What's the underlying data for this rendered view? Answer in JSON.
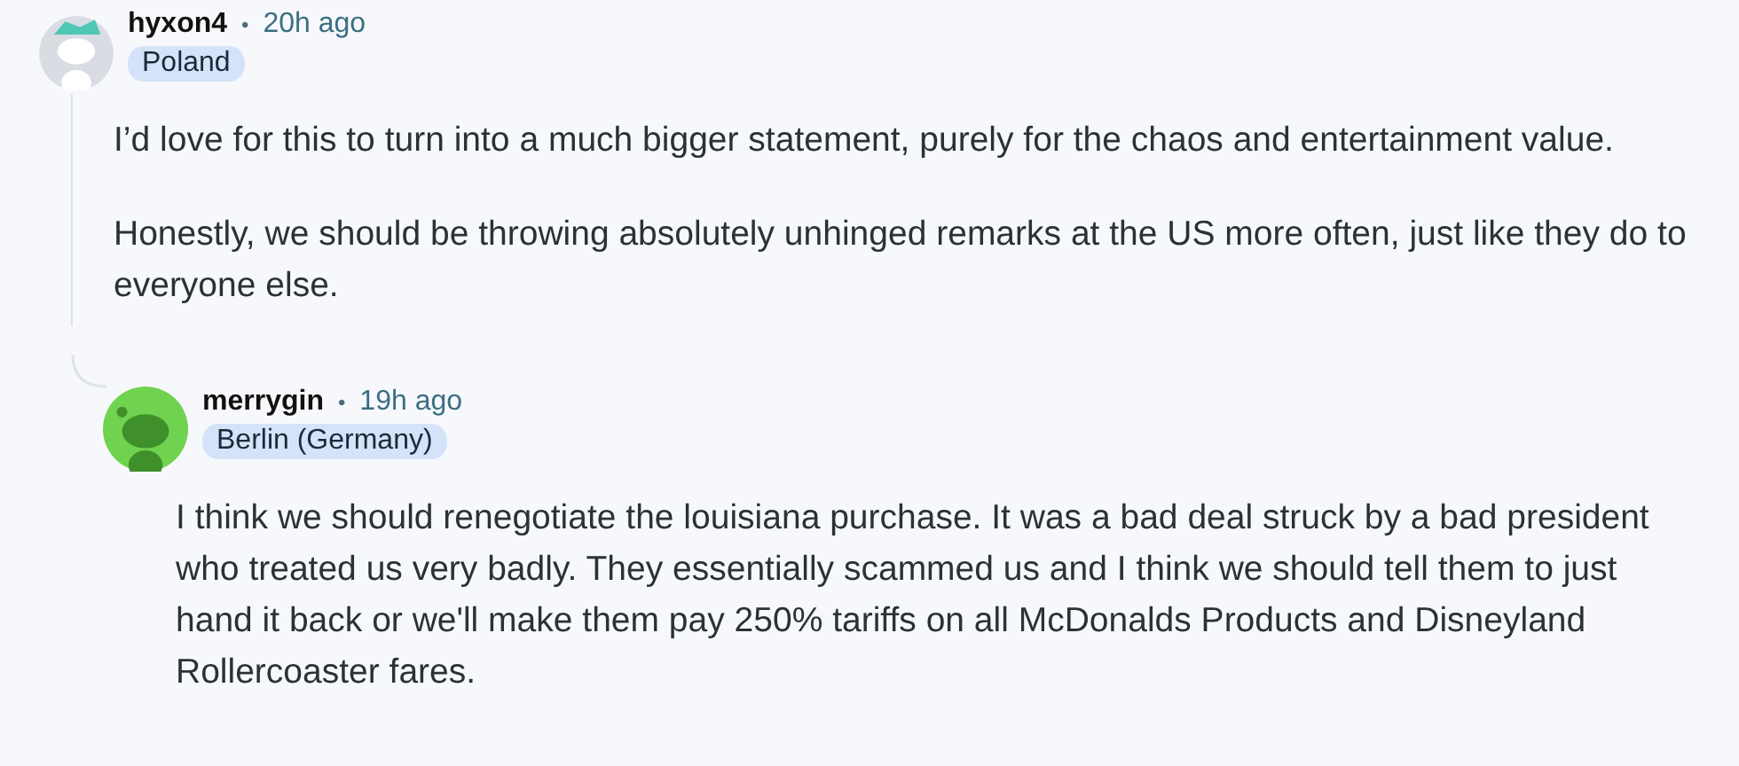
{
  "comments": [
    {
      "username": "hyxon4",
      "separator": "•",
      "time": "20h ago",
      "flair": "Poland",
      "paragraphs": [
        "I’d love for this to turn into a much bigger statement, purely for the chaos and entertainment value.",
        "Honestly, we should be throwing absolutely unhinged remarks at the US more often, just like they do to everyone else."
      ],
      "replies": [
        {
          "username": "merrygin",
          "separator": "•",
          "time": "19h ago",
          "flair": "Berlin (Germany)",
          "paragraphs": [
            "I think we should renegotiate the louisiana purchase. It was a bad deal struck by a bad president who treated us very badly. They essentially scammed us and I think we should tell them to just hand it back or we'll make them pay 250% tariffs on all McDonalds Products and Disneyland Rollercoaster fares."
          ]
        }
      ]
    }
  ]
}
